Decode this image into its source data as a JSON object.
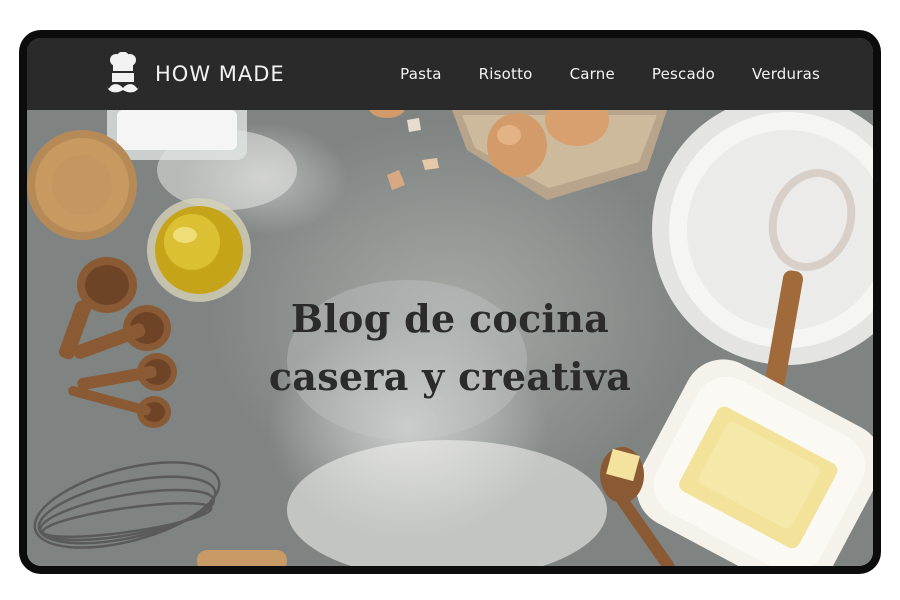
{
  "brand": {
    "name": "HOW MADE",
    "logo_icon": "chef-mustache-icon"
  },
  "nav": {
    "items": [
      {
        "label": "Pasta"
      },
      {
        "label": "Risotto"
      },
      {
        "label": "Carne"
      },
      {
        "label": "Pescado"
      },
      {
        "label": "Verduras"
      }
    ]
  },
  "hero": {
    "title_line1": "Blog de cocina",
    "title_line2": "casera y creativa"
  },
  "colors": {
    "navbar": "#2a2a2a",
    "nav_text": "#f2f2f2",
    "frame": "#0c0c0c",
    "title_text": "#2b2b2b"
  }
}
